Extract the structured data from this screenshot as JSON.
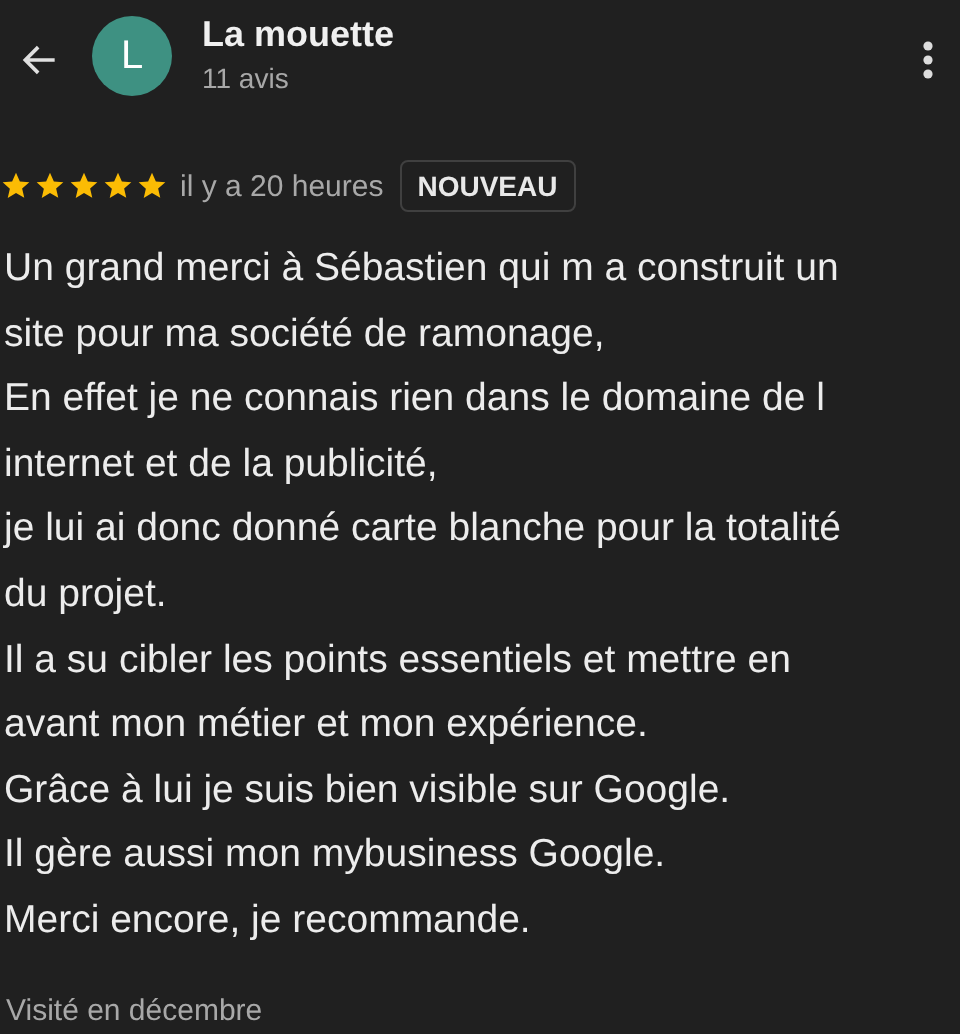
{
  "reviewer": {
    "initial": "L",
    "name": "La mouette",
    "review_count": "11 avis",
    "color": "#3e9182"
  },
  "review": {
    "stars": 5,
    "time": "il y a 20 heures",
    "badge": "NOUVEAU",
    "paragraphs": [
      "Un grand merci à Sébastien qui m a construit un site pour ma société de ramonage,",
      "En effet je ne connais rien dans le domaine de l internet et de la publicité,",
      "je lui ai donc donné carte blanche pour la totalité du projet.",
      "Il a su cibler les points essentiels et mettre en avant mon métier et mon expérience.",
      "Grâce à lui je suis bien visible sur Google.",
      "Il gère aussi mon mybusiness Google.",
      "Merci encore, je recommande."
    ],
    "visited": "Visité en décembre"
  }
}
